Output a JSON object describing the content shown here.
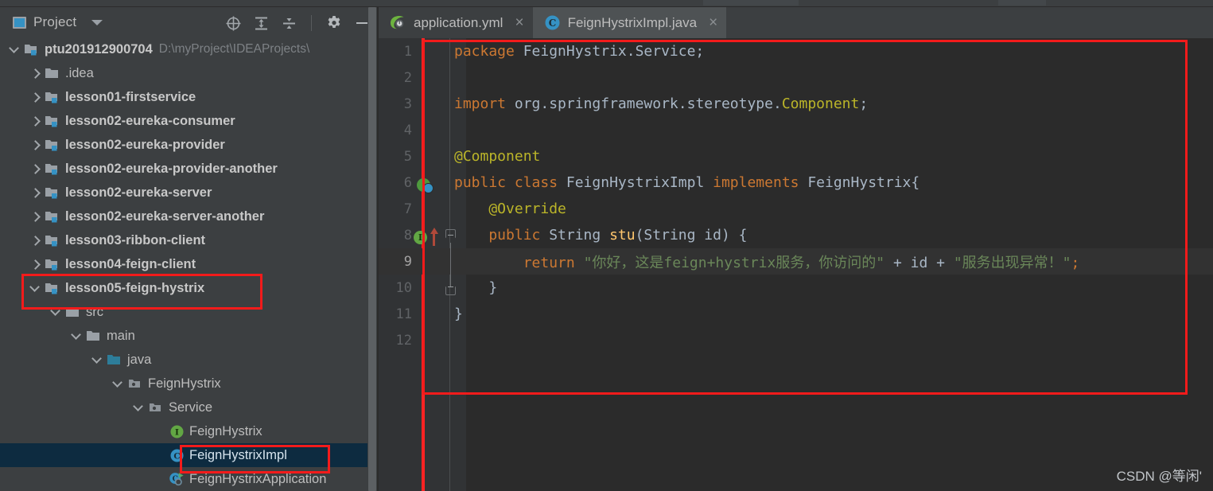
{
  "window": {
    "theme_bg": "#3c3f41",
    "editor_bg": "#2b2b2b",
    "accent": "#3592c4",
    "annotation_color": "#f31b1b"
  },
  "project_panel": {
    "title": "Project",
    "title_icon": "project-window-icon",
    "dropdown_icon": "chevron-down-icon",
    "tools": [
      {
        "name": "locate-in-tree-icon",
        "tooltip": "Select Opened File"
      },
      {
        "name": "expand-all-icon",
        "tooltip": "Expand All"
      },
      {
        "name": "collapse-all-icon",
        "tooltip": "Collapse All"
      },
      {
        "name": "settings-gear-icon",
        "tooltip": "Settings"
      },
      {
        "name": "hide-panel-icon",
        "tooltip": "Hide"
      }
    ]
  },
  "tree": {
    "items": [
      {
        "label": "ptu201912900704",
        "path": "D:\\myProject\\IDEAProjects\\",
        "indent": 0,
        "arrow": "down",
        "icon": "module-folder-icon",
        "bold": true,
        "selected": false
      },
      {
        "label": ".idea",
        "path": "",
        "indent": 1,
        "arrow": "right",
        "icon": "folder-icon",
        "bold": false,
        "selected": false
      },
      {
        "label": "lesson01-firstservice",
        "path": "",
        "indent": 1,
        "arrow": "right",
        "icon": "module-folder-icon",
        "bold": true,
        "selected": false
      },
      {
        "label": "lesson02-eureka-consumer",
        "path": "",
        "indent": 1,
        "arrow": "right",
        "icon": "module-folder-icon",
        "bold": true,
        "selected": false
      },
      {
        "label": "lesson02-eureka-provider",
        "path": "",
        "indent": 1,
        "arrow": "right",
        "icon": "module-folder-icon",
        "bold": true,
        "selected": false
      },
      {
        "label": "lesson02-eureka-provider-another",
        "path": "",
        "indent": 1,
        "arrow": "right",
        "icon": "module-folder-icon",
        "bold": true,
        "selected": false
      },
      {
        "label": "lesson02-eureka-server",
        "path": "",
        "indent": 1,
        "arrow": "right",
        "icon": "module-folder-icon",
        "bold": true,
        "selected": false
      },
      {
        "label": "lesson02-eureka-server-another",
        "path": "",
        "indent": 1,
        "arrow": "right",
        "icon": "module-folder-icon",
        "bold": true,
        "selected": false
      },
      {
        "label": "lesson03-ribbon-client",
        "path": "",
        "indent": 1,
        "arrow": "right",
        "icon": "module-folder-icon",
        "bold": true,
        "selected": false
      },
      {
        "label": "lesson04-feign-client",
        "path": "",
        "indent": 1,
        "arrow": "right",
        "icon": "module-folder-icon",
        "bold": true,
        "selected": false
      },
      {
        "label": "lesson05-feign-hystrix",
        "path": "",
        "indent": 1,
        "arrow": "down",
        "icon": "module-folder-icon",
        "bold": true,
        "selected": false
      },
      {
        "label": "src",
        "path": "",
        "indent": 2,
        "arrow": "down",
        "icon": "folder-icon",
        "bold": false,
        "selected": false
      },
      {
        "label": "main",
        "path": "",
        "indent": 3,
        "arrow": "down",
        "icon": "folder-icon",
        "bold": false,
        "selected": false
      },
      {
        "label": "java",
        "path": "",
        "indent": 4,
        "arrow": "down",
        "icon": "source-root-folder-icon",
        "bold": false,
        "selected": false
      },
      {
        "label": "FeignHystrix",
        "path": "",
        "indent": 5,
        "arrow": "down",
        "icon": "package-icon",
        "bold": false,
        "selected": false
      },
      {
        "label": "Service",
        "path": "",
        "indent": 6,
        "arrow": "down",
        "icon": "package-icon",
        "bold": false,
        "selected": false
      },
      {
        "label": "FeignHystrix",
        "path": "",
        "indent": 7,
        "arrow": "none",
        "icon": "java-interface-icon",
        "bold": false,
        "selected": false
      },
      {
        "label": "FeignHystrixImpl",
        "path": "",
        "indent": 7,
        "arrow": "none",
        "icon": "java-class-icon",
        "bold": false,
        "selected": true
      },
      {
        "label": "FeignHystrixApplication",
        "path": "",
        "indent": 7,
        "arrow": "none",
        "icon": "java-runnable-class-icon",
        "bold": false,
        "selected": false
      }
    ]
  },
  "editor": {
    "tabs": [
      {
        "label": "application.yml",
        "icon": "spring-yaml-icon",
        "active": false,
        "close_glyph": "×"
      },
      {
        "label": "FeignHystrixImpl.java",
        "icon": "java-class-icon",
        "active": true,
        "close_glyph": "×"
      }
    ],
    "lines": [
      {
        "num": "1",
        "current": false,
        "segments": [
          {
            "t": "package",
            "c": "kw"
          },
          {
            "t": " FeignHystrix.Service;",
            "c": "cls"
          }
        ]
      },
      {
        "num": "2",
        "current": false,
        "segments": []
      },
      {
        "num": "3",
        "current": false,
        "segments": [
          {
            "t": "import",
            "c": "kw"
          },
          {
            "t": " org.springframework.stereotype.",
            "c": "cls"
          },
          {
            "t": "Component",
            "c": "ann"
          },
          {
            "t": ";",
            "c": "cls"
          }
        ]
      },
      {
        "num": "4",
        "current": false,
        "segments": []
      },
      {
        "num": "5",
        "current": false,
        "segments": [
          {
            "t": "@Component",
            "c": "ann"
          }
        ]
      },
      {
        "num": "6",
        "current": false,
        "segments": [
          {
            "t": "public class",
            "c": "kw"
          },
          {
            "t": " FeignHystrixImpl ",
            "c": "cls"
          },
          {
            "t": "implements",
            "c": "kw"
          },
          {
            "t": " FeignHystrix{",
            "c": "cls"
          }
        ]
      },
      {
        "num": "7",
        "current": false,
        "segments": [
          {
            "t": "    @Override",
            "c": "ann"
          }
        ]
      },
      {
        "num": "8",
        "current": false,
        "segments": [
          {
            "t": "    public",
            "c": "kw"
          },
          {
            "t": " String ",
            "c": "cls"
          },
          {
            "t": "stu",
            "c": "mth"
          },
          {
            "t": "(String id) {",
            "c": "cls"
          }
        ]
      },
      {
        "num": "9",
        "current": true,
        "segments": [
          {
            "t": "        return",
            "c": "kw"
          },
          {
            "t": " ",
            "c": "cls"
          },
          {
            "t": "\"你好，这是feign+hystrix服务，你访问的\"",
            "c": "str"
          },
          {
            "t": " + ",
            "c": "cls"
          },
          {
            "t": "id",
            "c": "cls"
          },
          {
            "t": " + ",
            "c": "cls"
          },
          {
            "t": "\"服务出现异常！\"",
            "c": "str"
          },
          {
            "t": ";",
            "c": "kw"
          }
        ]
      },
      {
        "num": "10",
        "current": false,
        "segments": [
          {
            "t": "    }",
            "c": "cls"
          }
        ]
      },
      {
        "num": "11",
        "current": false,
        "segments": [
          {
            "t": "}",
            "c": "cls"
          }
        ]
      },
      {
        "num": "12",
        "current": false,
        "segments": []
      }
    ],
    "gutter_markers": [
      {
        "line": 6,
        "name": "spring-bean-gutter-icon",
        "kind": "bean"
      },
      {
        "line": 8,
        "name": "implementing-method-gutter-icon",
        "kind": "impl",
        "glyph": "I"
      }
    ]
  },
  "annotations": [
    {
      "name": "annotation-box-lesson05-module"
    },
    {
      "name": "annotation-box-feignhystriximpl-node"
    },
    {
      "name": "annotation-box-code-region"
    }
  ],
  "watermark": {
    "text": "CSDN @等闲'"
  }
}
